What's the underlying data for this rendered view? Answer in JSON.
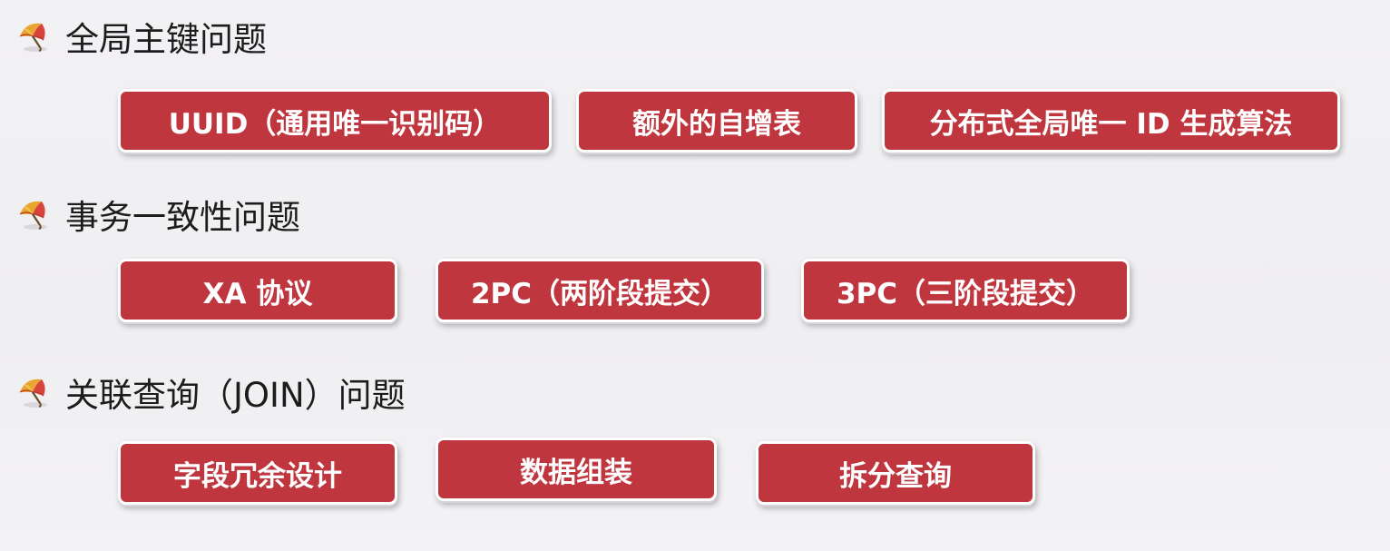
{
  "sections": [
    {
      "title": "全局主键问题",
      "buttons": [
        "UUID（通用唯一识别码）",
        "额外的自增表",
        "分布式全局唯一 ID 生成算法"
      ]
    },
    {
      "title": "事务一致性问题",
      "buttons": [
        "XA 协议",
        "2PC（两阶段提交）",
        "3PC（三阶段提交）"
      ]
    },
    {
      "title": "关联查询（JOIN）问题",
      "buttons": [
        "字段冗余设计",
        "数据组装",
        "拆分查询"
      ]
    }
  ],
  "colors": {
    "button_fill": "#c0363f",
    "button_border": "#ffffff",
    "heading_text": "#1c1c1c",
    "background": "#f1f0f3"
  },
  "icons": {
    "bullet": "umbrella-icon"
  }
}
